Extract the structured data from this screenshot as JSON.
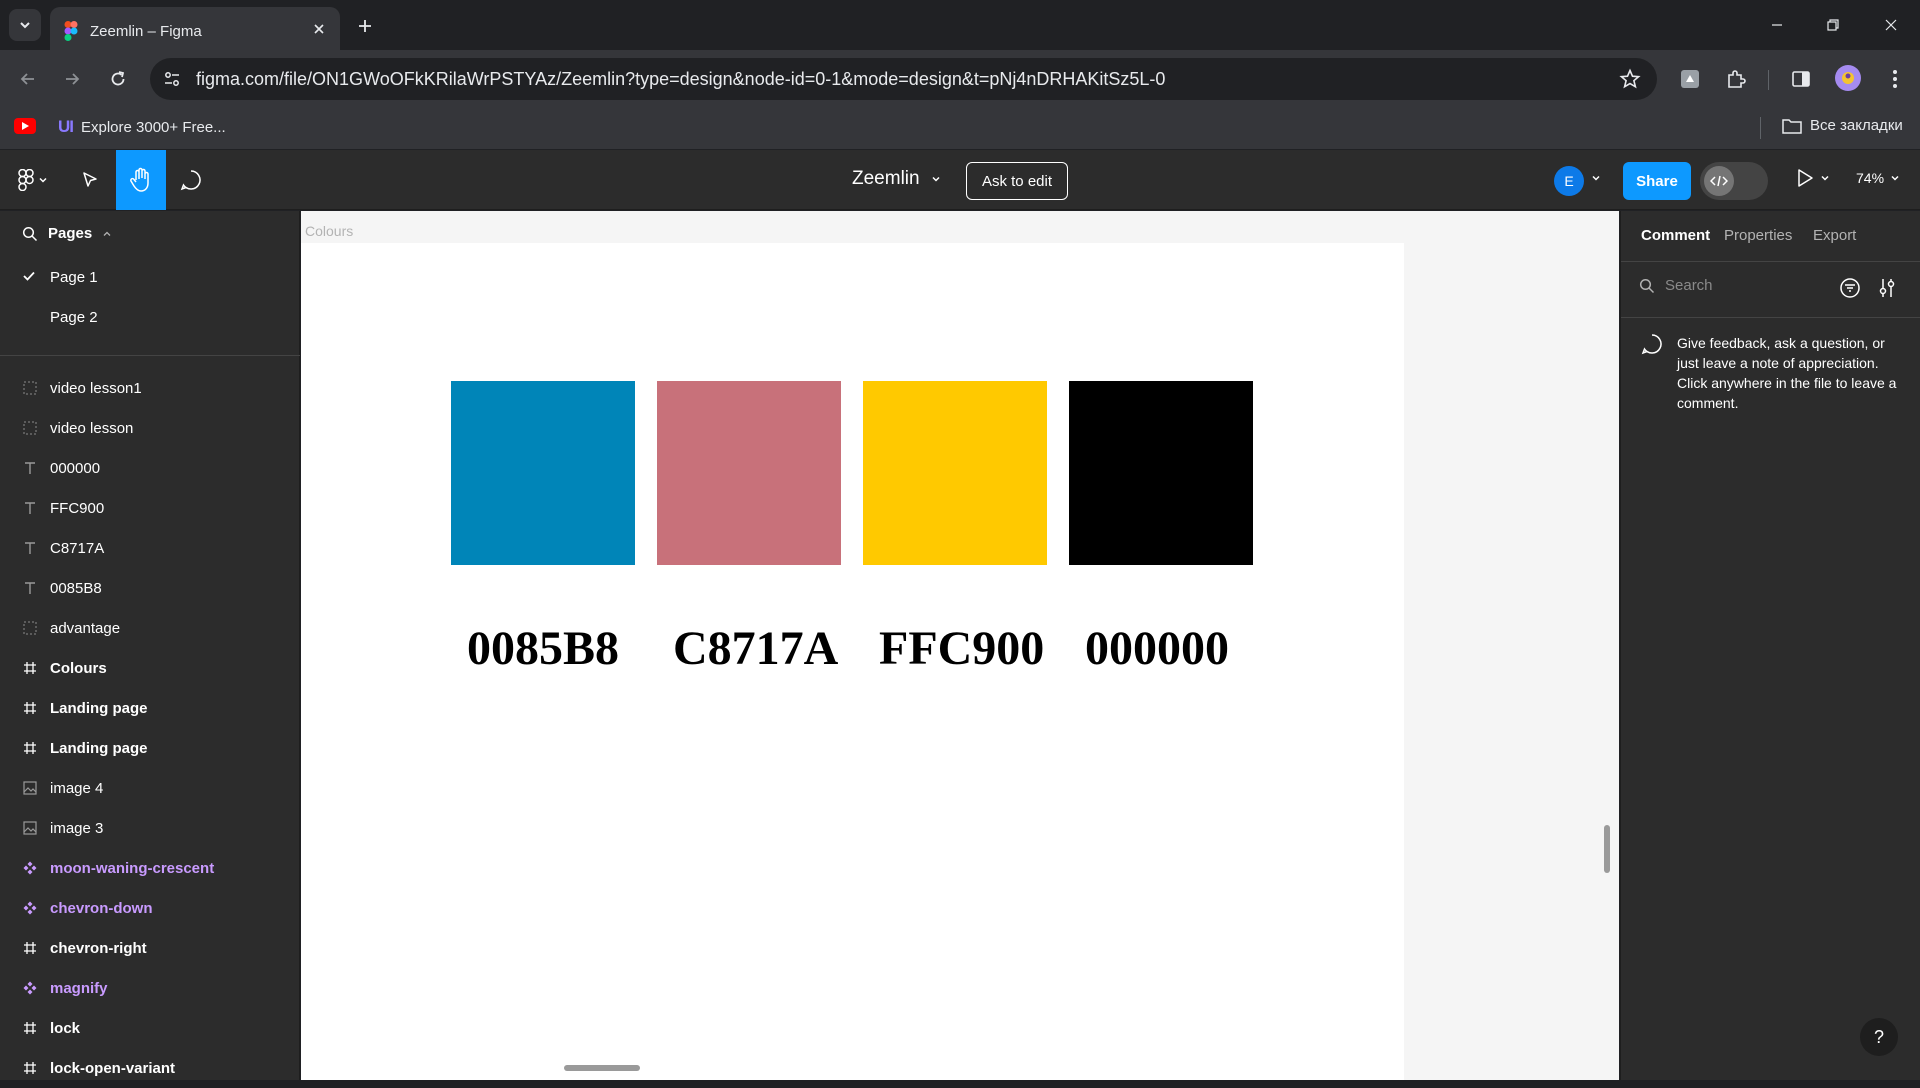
{
  "browser": {
    "tab_title": "Zeemlin – Figma",
    "url": "figma.com/file/ON1GWoOFkKRilaWrPSTYAz/Zeemlin?type=design&node-id=0-1&mode=design&t=pNj4nDRHAKitSz5L-0",
    "bookmark_label": "Explore 3000+ Free...",
    "bookmark_icon": "UI",
    "all_bookmarks": "Все закладки"
  },
  "figma": {
    "file_name": "Zeemlin",
    "ask_to_edit": "Ask to edit",
    "user_initial": "E",
    "share": "Share",
    "zoom": "74%"
  },
  "left_panel": {
    "pages_title": "Pages",
    "pages": [
      {
        "label": "Page 1",
        "selected": true
      },
      {
        "label": "Page 2",
        "selected": false
      }
    ],
    "layers": [
      {
        "name": "video lesson1",
        "type": "section"
      },
      {
        "name": "video lesson",
        "type": "section"
      },
      {
        "name": "000000",
        "type": "text"
      },
      {
        "name": "FFC900",
        "type": "text"
      },
      {
        "name": "C8717A",
        "type": "text"
      },
      {
        "name": "0085B8",
        "type": "text"
      },
      {
        "name": "advantage",
        "type": "section"
      },
      {
        "name": "Colours",
        "type": "frame"
      },
      {
        "name": "Landing page",
        "type": "frame"
      },
      {
        "name": "Landing page",
        "type": "frame"
      },
      {
        "name": "image 4",
        "type": "image"
      },
      {
        "name": "image 3",
        "type": "image"
      },
      {
        "name": "moon-waning-crescent",
        "type": "component"
      },
      {
        "name": "chevron-down",
        "type": "component"
      },
      {
        "name": "chevron-right",
        "type": "frame"
      },
      {
        "name": "magnify",
        "type": "component"
      },
      {
        "name": "lock",
        "type": "frame"
      },
      {
        "name": "lock-open-variant",
        "type": "frame"
      }
    ]
  },
  "canvas": {
    "frame_label": "Colours",
    "swatches": [
      {
        "label": "0085B8",
        "color": "#0085B8"
      },
      {
        "label": "C8717A",
        "color": "#C8717A"
      },
      {
        "label": "FFC900",
        "color": "#FFC900"
      },
      {
        "label": "000000",
        "color": "#000000"
      }
    ]
  },
  "right_panel": {
    "tabs": [
      "Comment",
      "Properties",
      "Export"
    ],
    "search_placeholder": "Search",
    "hint": "Give feedback, ask a question, or just leave a note of appreciation. Click anywhere in the file to leave a comment.",
    "help": "?"
  },
  "colors": {
    "accent": "#0d99ff",
    "component": "#c99bff"
  }
}
